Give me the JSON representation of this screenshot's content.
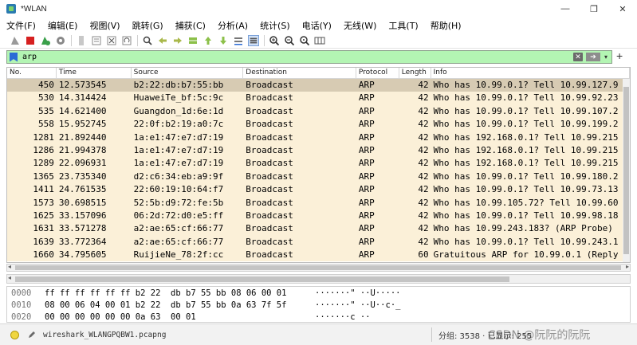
{
  "window": {
    "title": "*WLAN",
    "controls": [
      "—",
      "❐",
      "✕"
    ]
  },
  "menu": [
    "文件(F)",
    "编辑(E)",
    "视图(V)",
    "跳转(G)",
    "捕获(C)",
    "分析(A)",
    "统计(S)",
    "电话(Y)",
    "无线(W)",
    "工具(T)",
    "帮助(H)"
  ],
  "toolbar": {
    "icons": [
      "shark-fin-icon",
      "stop-icon",
      "restart-icon",
      "options-gear-icon",
      "open-file-icon",
      "file-set-icon",
      "close-file-icon",
      "reload-icon",
      "find-icon",
      "go-back-icon",
      "go-forward-icon",
      "go-to-packet-icon",
      "first-packet-icon",
      "last-packet-icon",
      "auto-scroll-icon",
      "colorize-icon",
      "zoom-in-icon",
      "zoom-out-icon",
      "zoom-normal-icon",
      "resize-columns-icon"
    ],
    "colors": {
      "stop": "#d62020",
      "fin": "#2a7ab0"
    }
  },
  "filter": {
    "value": "arp",
    "bg": "#b3f5b3",
    "plus": "+"
  },
  "columns": [
    "No.",
    "Time",
    "Source",
    "Destination",
    "Protocol",
    "Length",
    "Info"
  ],
  "packets": [
    {
      "no": "450",
      "time": "12.573545",
      "src": "b2:22:db:b7:55:bb",
      "dst": "Broadcast",
      "proto": "ARP",
      "len": "42",
      "info": "Who has 10.99.0.1? Tell 10.99.127.9"
    },
    {
      "no": "530",
      "time": "14.314424",
      "src": "HuaweiTe_bf:5c:9c",
      "dst": "Broadcast",
      "proto": "ARP",
      "len": "42",
      "info": "Who has 10.99.0.1? Tell 10.99.92.23"
    },
    {
      "no": "535",
      "time": "14.621400",
      "src": "Guangdon_1d:6e:1d",
      "dst": "Broadcast",
      "proto": "ARP",
      "len": "42",
      "info": "Who has 10.99.0.1? Tell 10.99.107.2"
    },
    {
      "no": "558",
      "time": "15.952745",
      "src": "22:0f:b2:19:a0:7c",
      "dst": "Broadcast",
      "proto": "ARP",
      "len": "42",
      "info": "Who has 10.99.0.1? Tell 10.99.199.2"
    },
    {
      "no": "1281",
      "time": "21.892440",
      "src": "1a:e1:47:e7:d7:19",
      "dst": "Broadcast",
      "proto": "ARP",
      "len": "42",
      "info": "Who has 192.168.0.1? Tell 10.99.215"
    },
    {
      "no": "1286",
      "time": "21.994378",
      "src": "1a:e1:47:e7:d7:19",
      "dst": "Broadcast",
      "proto": "ARP",
      "len": "42",
      "info": "Who has 192.168.0.1? Tell 10.99.215"
    },
    {
      "no": "1289",
      "time": "22.096931",
      "src": "1a:e1:47:e7:d7:19",
      "dst": "Broadcast",
      "proto": "ARP",
      "len": "42",
      "info": "Who has 192.168.0.1? Tell 10.99.215"
    },
    {
      "no": "1365",
      "time": "23.735340",
      "src": "d2:c6:34:eb:a9:9f",
      "dst": "Broadcast",
      "proto": "ARP",
      "len": "42",
      "info": "Who has 10.99.0.1? Tell 10.99.180.2"
    },
    {
      "no": "1411",
      "time": "24.761535",
      "src": "22:60:19:10:64:f7",
      "dst": "Broadcast",
      "proto": "ARP",
      "len": "42",
      "info": "Who has 10.99.0.1? Tell 10.99.73.13"
    },
    {
      "no": "1573",
      "time": "30.698515",
      "src": "52:5b:d9:72:fe:5b",
      "dst": "Broadcast",
      "proto": "ARP",
      "len": "42",
      "info": "Who has 10.99.105.72? Tell 10.99.60"
    },
    {
      "no": "1625",
      "time": "33.157096",
      "src": "06:2d:72:d0:e5:ff",
      "dst": "Broadcast",
      "proto": "ARP",
      "len": "42",
      "info": "Who has 10.99.0.1? Tell 10.99.98.18"
    },
    {
      "no": "1631",
      "time": "33.571278",
      "src": "a2:ae:65:cf:66:77",
      "dst": "Broadcast",
      "proto": "ARP",
      "len": "42",
      "info": "Who has 10.99.243.183? (ARP Probe)"
    },
    {
      "no": "1639",
      "time": "33.772364",
      "src": "a2:ae:65:cf:66:77",
      "dst": "Broadcast",
      "proto": "ARP",
      "len": "42",
      "info": "Who has 10.99.0.1? Tell 10.99.243.1"
    },
    {
      "no": "1660",
      "time": "34.795605",
      "src": "RuijieNe_78:2f:cc",
      "dst": "Broadcast",
      "proto": "ARP",
      "len": "60",
      "info": "Gratuitous ARP for 10.99.0.1 (Reply"
    }
  ],
  "row_colors": {
    "normal": "#fbf0d8",
    "selected": "#d7cbb3"
  },
  "bytes": [
    {
      "off": "0000",
      "hex": "ff ff ff ff ff ff b2 22  db b7 55 bb 08 06 00 01",
      "ascii": "·······\" ··U·····"
    },
    {
      "off": "0010",
      "hex": "08 00 06 04 00 01 b2 22  db b7 55 bb 0a 63 7f 5f",
      "ascii": "·······\" ··U··c·_"
    },
    {
      "off": "0020",
      "hex": "00 00 00 00 00 00 0a 63  00 01",
      "ascii": "·······c ··"
    }
  ],
  "status": {
    "file": "wireshark_WLANGPQBW1.pcapng",
    "stats": "分组: 3538 · 已显示: 255",
    "watermark": "CSDN @阮阮的阮阮"
  }
}
